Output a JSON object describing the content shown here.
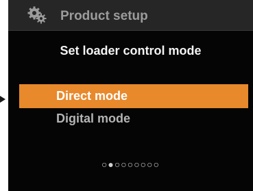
{
  "header": {
    "icon": "gears-icon",
    "title": "Product setup"
  },
  "screen": {
    "subtitle": "Set loader control mode"
  },
  "menu": {
    "items": [
      {
        "label": "Direct mode",
        "selected": true
      },
      {
        "label": "Digital mode",
        "selected": false
      }
    ]
  },
  "pager": {
    "indicator": "○●○○○○○○○"
  },
  "colors": {
    "screen_background": "#050505",
    "header_background": "#262626",
    "header_text": "#9c9c9c",
    "selected_background": "#e8892c",
    "selected_text": "#ffffff",
    "unselected_text": "#b4b4b4"
  }
}
